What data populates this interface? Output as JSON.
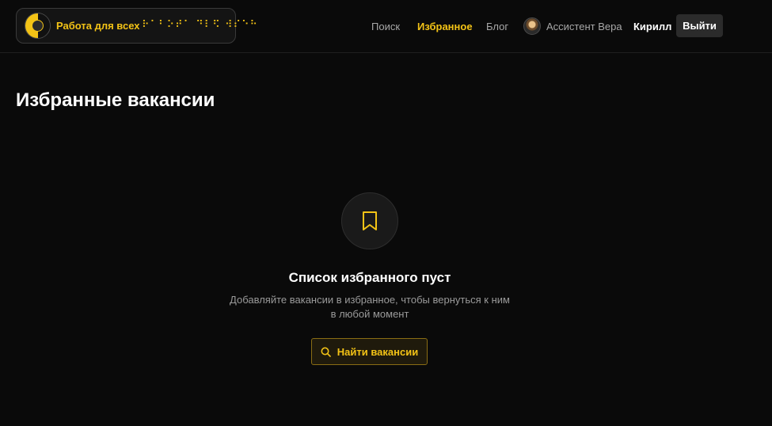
{
  "header": {
    "logo_text": "Работа для всех",
    "braille_text": "⠗⠁⠃⠕⠞⠁ ⠙⠇⠫ ⠺⠎⠑⠓",
    "nav": {
      "search": "Поиск",
      "favorites": "Избранное",
      "blog": "Блог"
    },
    "assistant_label": "Ассистент Вера",
    "user_name": "Кирилл",
    "logout_label": "Выйти"
  },
  "main": {
    "title": "Избранные вакансии",
    "empty_state": {
      "title": "Список избранного пуст",
      "description": "Добавляйте вакансии в избранное, чтобы вернуться к ним в любой момент",
      "button_label": "Найти вакансии"
    }
  },
  "colors": {
    "accent": "#f3c316",
    "background": "#0a0a0a"
  },
  "icons": {
    "empty_state": "bookmark-icon",
    "button": "search-icon"
  }
}
